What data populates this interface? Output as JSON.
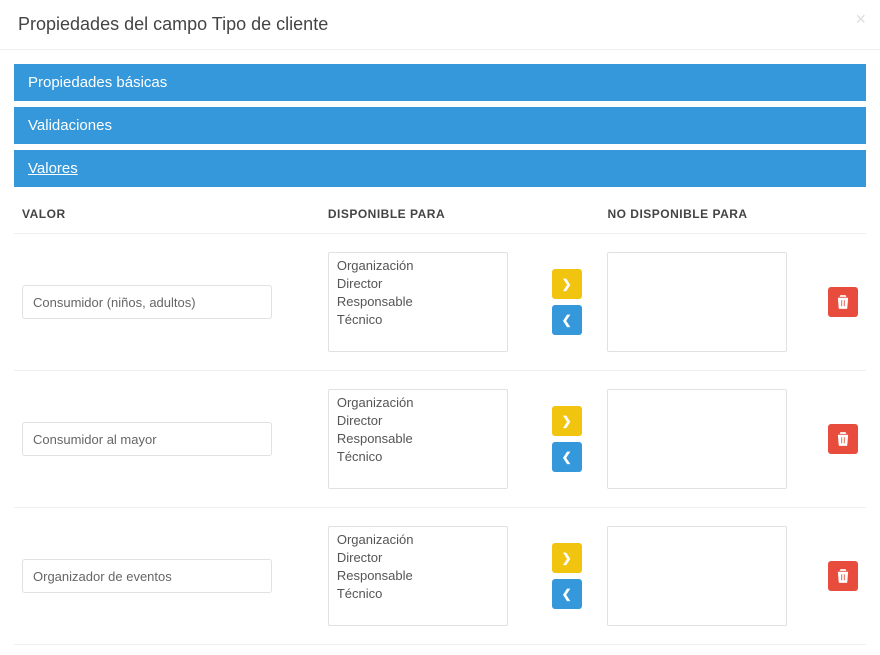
{
  "header": {
    "title": "Propiedades del campo Tipo de cliente",
    "close_glyph": "×"
  },
  "panels": {
    "p0": "Propiedades básicas",
    "p1": "Validaciones",
    "p2": "Valores"
  },
  "columns": {
    "value": "Valor",
    "available": "Disponible para",
    "not_available": "No disponible para"
  },
  "options": {
    "o0": "Organización",
    "o1": "Director",
    "o2": "Responsable",
    "o3": "Técnico"
  },
  "rows": {
    "r0": {
      "value": "Consumidor (niños, adultos)"
    },
    "r1": {
      "value": "Consumidor al mayor"
    },
    "r2": {
      "value": "Organizador de eventos"
    }
  },
  "glyphs": {
    "chev_right": "❯",
    "chev_left": "❮"
  }
}
